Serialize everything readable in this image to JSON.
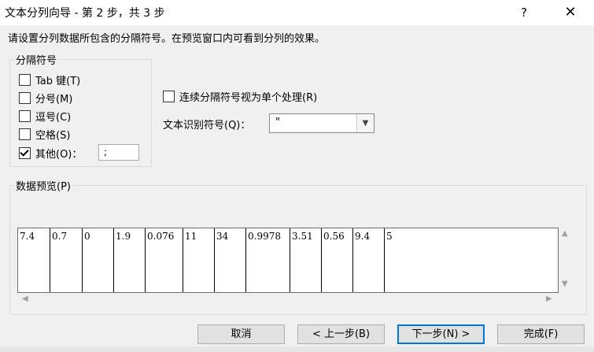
{
  "window": {
    "title": "文本分列向导 - 第 2 步，共 3 步",
    "help": "?",
    "close": "✕"
  },
  "instruction": "请设置分列数据所包含的分隔符号。在预览窗口内可看到分列的效果。",
  "delimiters": {
    "title": "分隔符号",
    "items": [
      {
        "label": "Tab 键(T)",
        "checked": false
      },
      {
        "label": "分号(M)",
        "checked": false
      },
      {
        "label": "逗号(C)",
        "checked": false
      },
      {
        "label": "空格(S)",
        "checked": false
      },
      {
        "label": "其他(O)：",
        "checked": true
      }
    ],
    "other_value": ";"
  },
  "consecutive": {
    "label": "连续分隔符号视为单个处理(R)",
    "checked": false
  },
  "text_qualifier": {
    "label": "文本识别符号(Q)：",
    "value": "\""
  },
  "preview": {
    "title": "数据预览(P)",
    "cells": [
      "7.4",
      "0.7",
      "0",
      "1.9",
      "0.076",
      "11",
      "34",
      "0.9978",
      "3.51",
      "0.56",
      "9.4",
      "5"
    ]
  },
  "buttons": {
    "cancel": "取消",
    "back": "< 上一步(B)",
    "next": "下一步(N) >",
    "finish": "完成(F)"
  }
}
